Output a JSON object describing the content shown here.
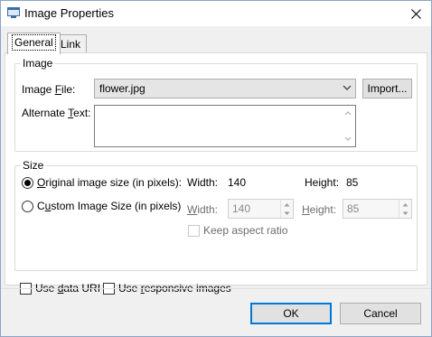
{
  "window": {
    "title": "Image Properties"
  },
  "tabs": [
    {
      "label": "General",
      "active": true
    },
    {
      "label": "Link",
      "active": false
    }
  ],
  "image_group": {
    "title": "Image",
    "file_label_pre": "Image ",
    "file_label_u": "F",
    "file_label_post": "ile:",
    "file_value": "flower.jpg",
    "import_label": "Import...",
    "alt_label_pre": "Alternate ",
    "alt_label_u": "T",
    "alt_label_post": "ext:",
    "alt_value": ""
  },
  "size_group": {
    "title": "Size",
    "original_label_u": "O",
    "original_label_post": "riginal image size (in pixels):",
    "original_width_label": "Width:",
    "original_width_value": "140",
    "original_height_label": "Height:",
    "original_height_value": "85",
    "custom_label_pre": "C",
    "custom_label_u": "u",
    "custom_label_post": "stom Image Size (in pixels)",
    "custom_width_label_u": "W",
    "custom_width_label_post": "idth:",
    "custom_width_value": "140",
    "custom_height_label_u": "H",
    "custom_height_label_post": "eight:",
    "custom_height_value": "85",
    "keep_aspect_label": "Keep aspect ratio"
  },
  "options": {
    "data_uri_pre": "Use ",
    "data_uri_u": "d",
    "data_uri_post": "ata URI",
    "responsive_pre": "Use ",
    "responsive_u": "r",
    "responsive_post": "esponsive images"
  },
  "footer": {
    "ok_label": "OK",
    "cancel_label": "Cancel"
  },
  "state": {
    "original_selected": true,
    "data_uri_checked": false,
    "responsive_checked": false,
    "keep_aspect_checked": false
  },
  "icons": [
    "app-window-icon",
    "close-icon",
    "chevron-down-icon",
    "scroll-up-icon",
    "scroll-down-icon",
    "spin-up-icon",
    "spin-down-icon"
  ],
  "colors": {
    "accent": "#0078d7",
    "window_bg": "#f0f0f0",
    "panel_bg": "#ffffff",
    "button_bg": "#e1e1e1"
  }
}
